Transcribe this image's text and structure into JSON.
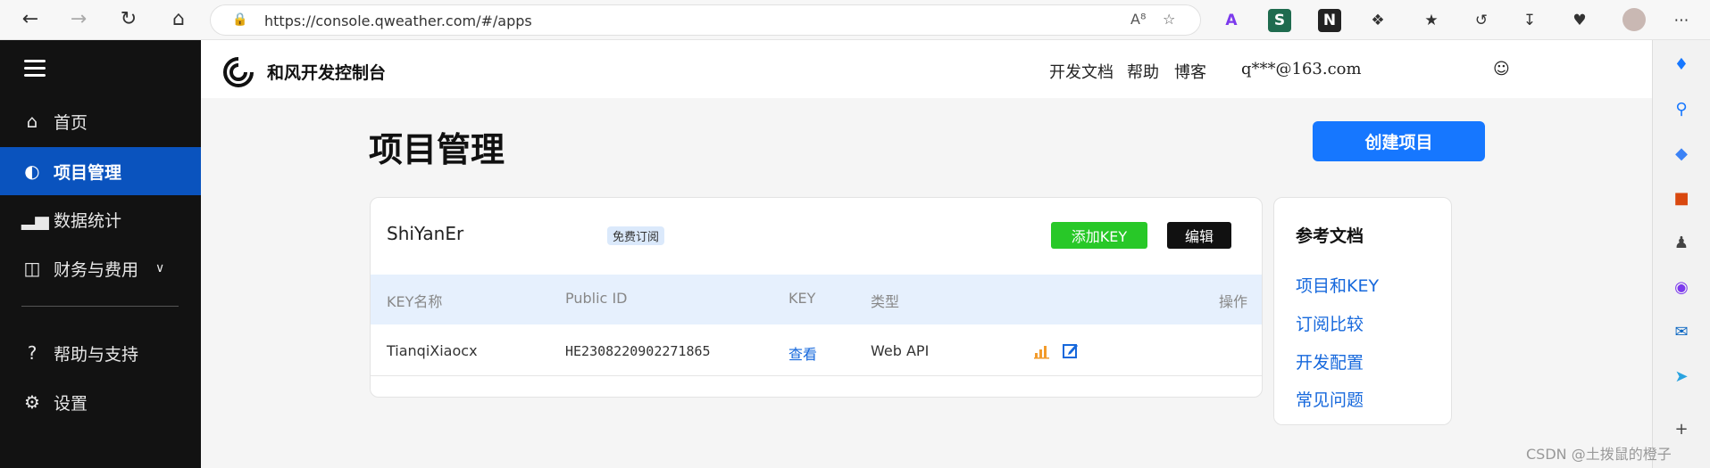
{
  "browser": {
    "url": "https://console.qweather.com/#/apps",
    "nav_icons": [
      "back-icon",
      "forward-icon",
      "refresh-icon",
      "home-icon"
    ],
    "toolbar_icons": [
      "read-aloud-icon",
      "add-favorite-icon",
      "extension-icon",
      "favorites-icon",
      "history-icon",
      "downloads-icon",
      "performance-icon",
      "profile-icon",
      "more-icon"
    ]
  },
  "sidebar": {
    "items": [
      {
        "label": "首页",
        "icon": "home-icon"
      },
      {
        "label": "项目管理",
        "icon": "project-icon",
        "active": true
      },
      {
        "label": "数据统计",
        "icon": "chart-icon"
      },
      {
        "label": "财务与费用",
        "icon": "wallet-icon"
      },
      {
        "label": "帮助与支持",
        "icon": "help-icon"
      },
      {
        "label": "设置",
        "icon": "gear-icon"
      }
    ]
  },
  "header": {
    "brand": "和风开发控制台",
    "links": [
      "开发文档",
      "帮助",
      "博客"
    ],
    "user": "q***@163.com"
  },
  "page": {
    "title": "项目管理",
    "create_button": "创建项目"
  },
  "project": {
    "name": "ShiYanEr",
    "badge": "免费订阅",
    "add_key_button": "添加KEY",
    "edit_button": "编辑",
    "columns": [
      "KEY名称",
      "Public ID",
      "KEY",
      "类型",
      "操作"
    ],
    "rows": [
      {
        "key_name": "TianqiXiaocx",
        "public_id": "HE2308220902271865",
        "key": "查看",
        "type": "Web API"
      }
    ]
  },
  "reference": {
    "title": "参考文档",
    "links": [
      "项目和KEY",
      "订阅比较",
      "开发配置",
      "常见问题"
    ]
  },
  "watermark": "CSDN @土拨鼠的橙子",
  "colors": {
    "accent": "#1677ff",
    "sidebar_active": "#0a53be",
    "add_key": "#28c828",
    "link": "#1668dc"
  }
}
